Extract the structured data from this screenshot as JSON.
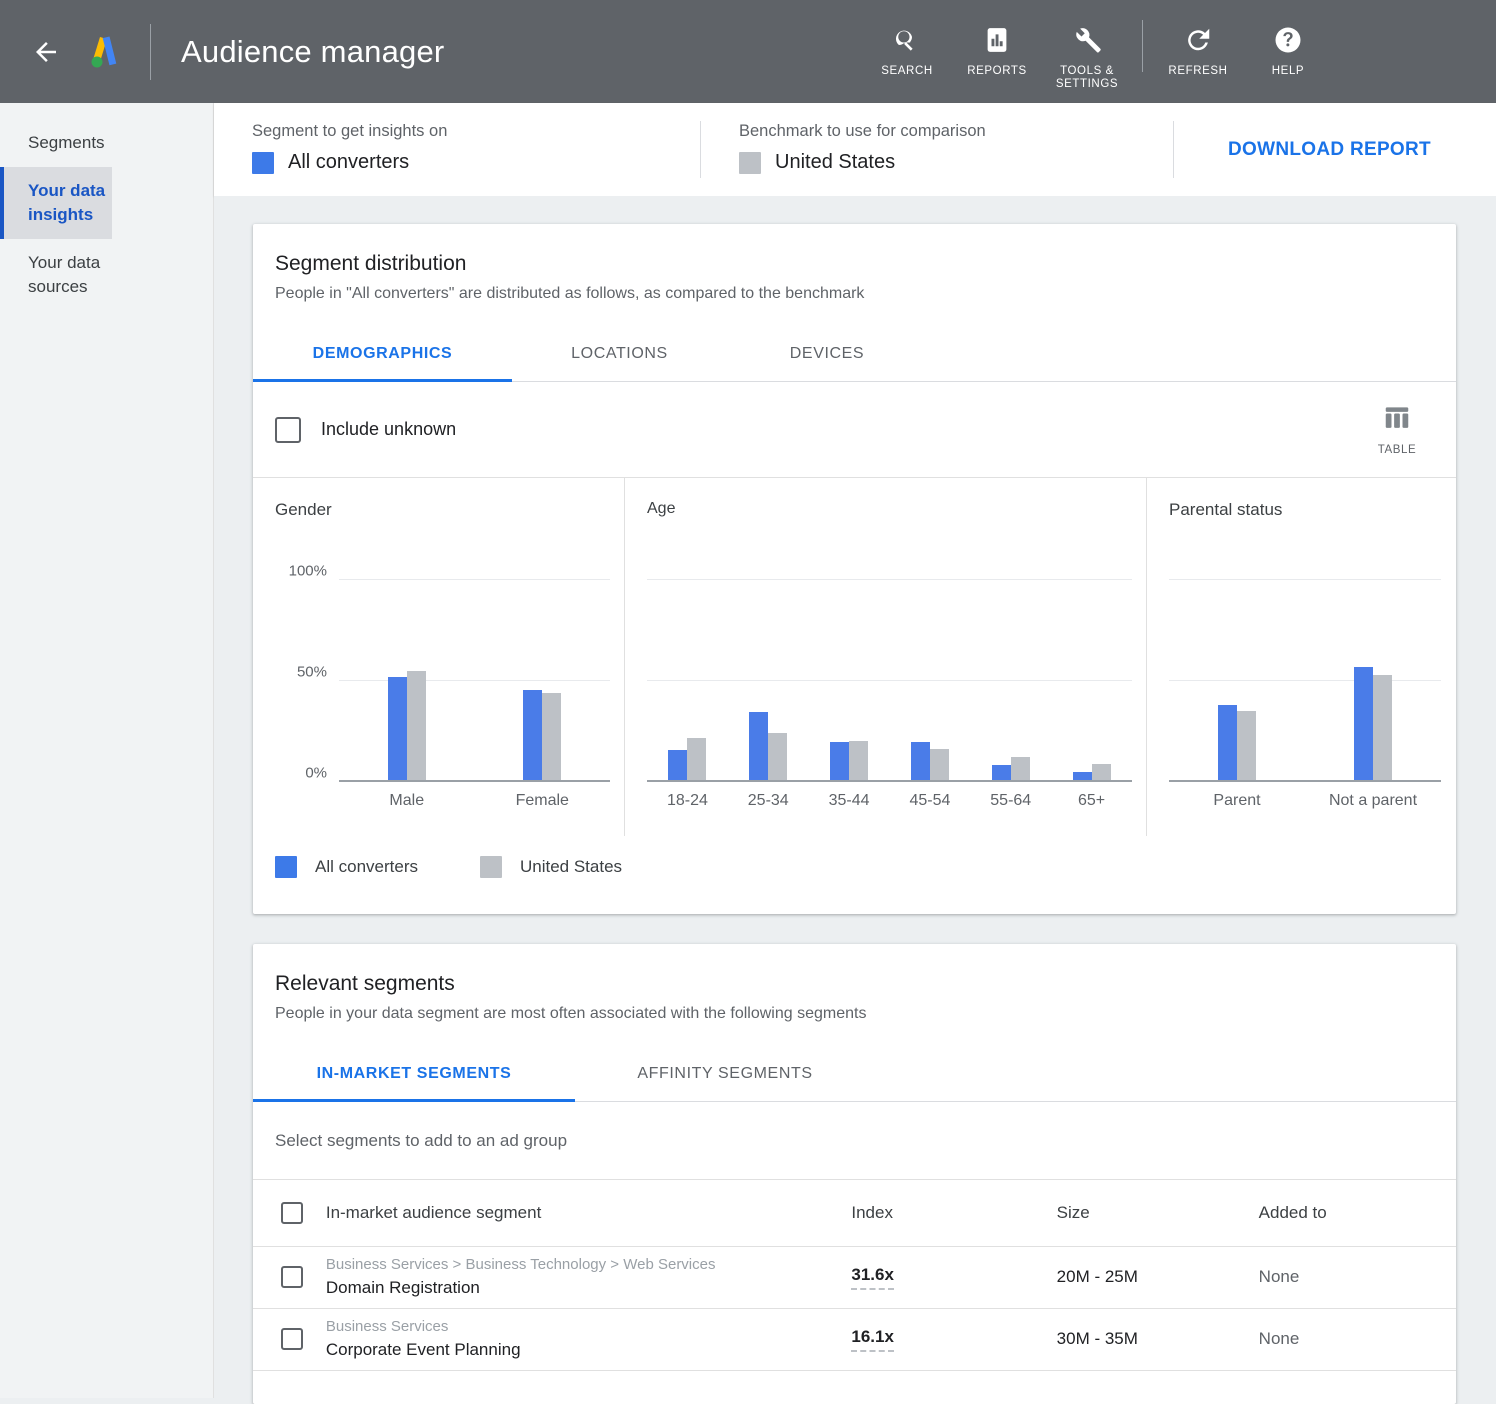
{
  "appbar": {
    "back_label": "back-arrow",
    "title": "Audience manager",
    "actions": [
      {
        "icon": "search-icon",
        "label": "SEARCH"
      },
      {
        "icon": "reports-icon",
        "label": "REPORTS"
      },
      {
        "icon": "wrench-icon",
        "label": "TOOLS & SETTINGS"
      },
      {
        "icon": "refresh-icon",
        "label": "REFRESH"
      },
      {
        "icon": "help-icon",
        "label": "HELP"
      }
    ]
  },
  "sidebar": {
    "items": [
      {
        "label": "Segments",
        "active": false
      },
      {
        "label": "Your data insights",
        "active": true
      },
      {
        "label": "Your data sources",
        "active": false
      }
    ]
  },
  "filterbar": {
    "segment_label": "Segment to get insights on",
    "segment_value": "All converters",
    "segment_color": "#3d7ae8",
    "benchmark_label": "Benchmark to use for comparison",
    "benchmark_value": "United States",
    "benchmark_color": "#bdc1c6",
    "download_label": "DOWNLOAD REPORT"
  },
  "distribution": {
    "title": "Segment distribution",
    "subtitle": "People in \"All converters\" are distributed as follows, as compared to the benchmark",
    "tabs": [
      {
        "label": "DEMOGRAPHICS",
        "active": true
      },
      {
        "label": "LOCATIONS",
        "active": false
      },
      {
        "label": "DEVICES",
        "active": false
      }
    ],
    "include_unknown_label": "Include unknown",
    "include_unknown_checked": false,
    "table_button_label": "TABLE",
    "legend": [
      {
        "label": "All converters",
        "color": "#3d7ae8"
      },
      {
        "label": "United States",
        "color": "#bdc1c6"
      }
    ]
  },
  "chart_data": [
    {
      "type": "bar",
      "title": "Gender",
      "categories": [
        "Male",
        "Female"
      ],
      "series": [
        {
          "name": "All converters",
          "color": "#4a7ce8",
          "values": [
            51,
            44.5
          ]
        },
        {
          "name": "United States",
          "color": "#bdc1c6",
          "values": [
            54,
            43
          ]
        }
      ],
      "ylabel": "",
      "xlabel": "",
      "ylim": [
        0,
        115
      ],
      "yticks": [
        0,
        50,
        100
      ],
      "ytick_labels": [
        "0%",
        "50%",
        "100%"
      ],
      "show_y_axis": true,
      "grid": true
    },
    {
      "type": "bar",
      "title": "Age",
      "categories": [
        "18-24",
        "25-34",
        "35-44",
        "45-54",
        "55-64",
        "65+"
      ],
      "series": [
        {
          "name": "All converters",
          "color": "#4a7ce8",
          "values": [
            15,
            33.5,
            19,
            19,
            7.5,
            4
          ]
        },
        {
          "name": "United States",
          "color": "#bdc1c6",
          "values": [
            21,
            23.5,
            19.5,
            15.5,
            11.5,
            8
          ]
        }
      ],
      "ylabel": "",
      "xlabel": "",
      "ylim": [
        0,
        115
      ],
      "yticks": [
        0,
        50,
        100
      ],
      "ytick_labels": [
        "",
        "",
        ""
      ],
      "show_y_axis": false,
      "grid": true
    },
    {
      "type": "bar",
      "title": "Parental status",
      "categories": [
        "Parent",
        "Not a parent"
      ],
      "series": [
        {
          "name": "All converters",
          "color": "#4a7ce8",
          "values": [
            37,
            56
          ]
        },
        {
          "name": "United States",
          "color": "#bdc1c6",
          "values": [
            34,
            52
          ]
        }
      ],
      "ylabel": "",
      "xlabel": "",
      "ylim": [
        0,
        115
      ],
      "yticks": [
        0,
        50,
        100
      ],
      "ytick_labels": [
        "",
        "",
        ""
      ],
      "show_y_axis": false,
      "grid": true
    }
  ],
  "segments": {
    "title": "Relevant segments",
    "subtitle": "People in your data segment are most often associated with the following segments",
    "tabs": [
      {
        "label": "IN-MARKET SEGMENTS",
        "active": true
      },
      {
        "label": "AFFINITY SEGMENTS",
        "active": false
      }
    ],
    "select_hint": "Select segments to add to an ad group",
    "columns": [
      "In-market audience segment",
      "Index",
      "Size",
      "Added to"
    ],
    "rows": [
      {
        "crumb": "Business Services > Business Technology > Web Services",
        "name": "Domain Registration",
        "index": "31.6x",
        "size": "20M - 25M",
        "added_to": "None",
        "checked": false
      },
      {
        "crumb": "Business Services",
        "name": "Corporate Event Planning",
        "index": "16.1x",
        "size": "30M - 35M",
        "added_to": "None",
        "checked": false
      }
    ]
  }
}
